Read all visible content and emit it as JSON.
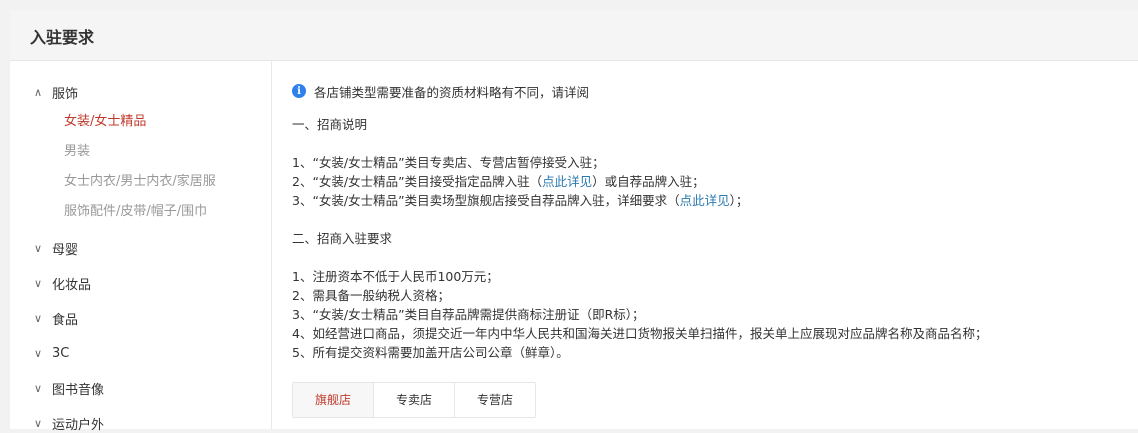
{
  "header": {
    "title": "入驻要求"
  },
  "sidebar": {
    "categories": [
      {
        "label": "服饰",
        "expanded": true
      },
      {
        "label": "母婴",
        "expanded": false
      },
      {
        "label": "化妆品",
        "expanded": false
      },
      {
        "label": "食品",
        "expanded": false
      },
      {
        "label": "3C",
        "expanded": false
      },
      {
        "label": "图书音像",
        "expanded": false
      },
      {
        "label": "运动户外",
        "expanded": false
      }
    ],
    "sub_items": [
      {
        "label": "女装/女士精品",
        "active": true
      },
      {
        "label": "男装",
        "active": false
      },
      {
        "label": "女士内衣/男士内衣/家居服",
        "active": false
      },
      {
        "label": "服饰配件/皮带/帽子/围巾",
        "active": false
      }
    ]
  },
  "content": {
    "notice": "各店铺类型需要准备的资质材料略有不同，请详阅",
    "section1": {
      "title": "一、招商说明",
      "line1": "1、“女装/女士精品”类目专卖店、专营店暂停接受入驻；",
      "line2_pre": "2、“女装/女士精品”类目接受指定品牌入驻（",
      "line2_link": "点此详见",
      "line2_post": "）或自荐品牌入驻；",
      "line3_pre": "3、“女装/女士精品”类目卖场型旗舰店接受自荐品牌入驻，详细要求（",
      "line3_link": "点此详见",
      "line3_post": "）；"
    },
    "section2": {
      "title": "二、招商入驻要求",
      "items": [
        "1、注册资本不低于人民币100万元；",
        "2、需具备一般纳税人资格；",
        "3、“女装/女士精品”类目自荐品牌需提供商标注册证（即R标）；",
        "4、如经营进口商品，须提交近一年内中华人民共和国海关进口货物报关单扫描件，报关单上应展现对应品牌名称及商品名称；",
        "5、所有提交资料需要加盖开店公司公章（鲜章）。"
      ]
    },
    "tabs": [
      "旗舰店",
      "专卖店",
      "专营店"
    ],
    "active_tab": "旗舰店"
  },
  "colors": {
    "accent": "#c0392b",
    "link": "#2a7ab0",
    "info": "#2f80ed"
  }
}
